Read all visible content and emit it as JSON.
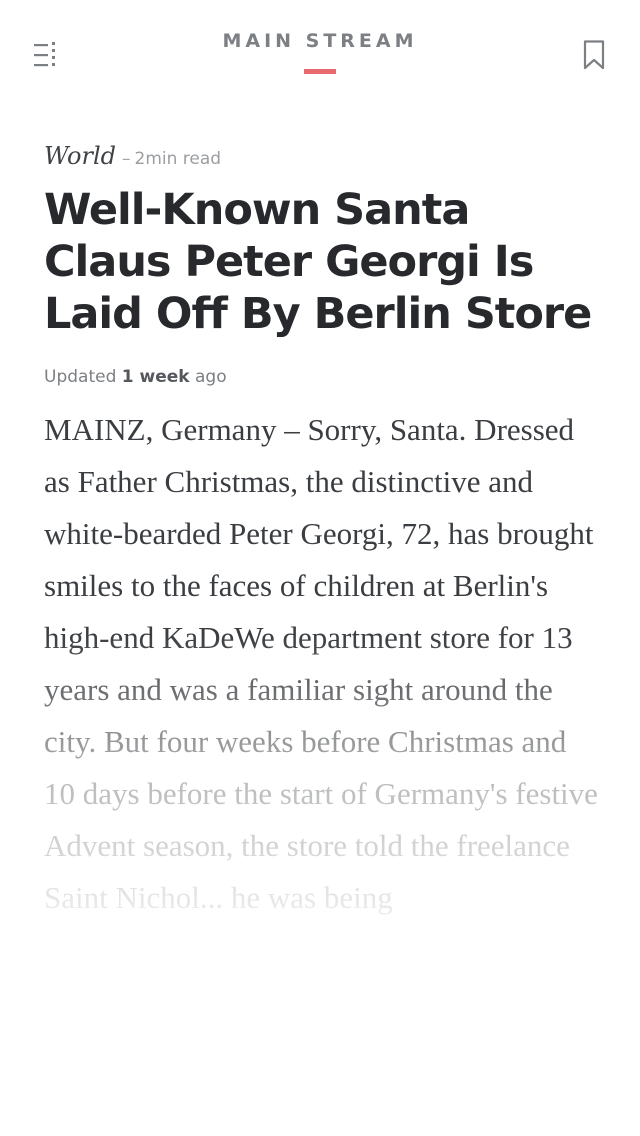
{
  "header": {
    "title": "MAIN STREAM",
    "menu_icon": "menu-icon",
    "bookmark_icon": "bookmark-icon",
    "accent_color": "#e86a6f"
  },
  "article": {
    "category": "World",
    "separator": "–",
    "read_time": "2min read",
    "headline": "Well-Known Santa Claus Peter Georgi Is Laid Off By Berlin Store",
    "updated_prefix": "Updated",
    "updated_value": "1 week",
    "updated_suffix": "ago",
    "body": "MAINZ, Germany – Sorry, Santa. Dressed as Father Christmas, the distinctive and white-bearded Peter Georgi, 72, has brought smiles to the faces of children at Berlin's high-end KaDeWe department store for 13 years and was a familiar sight around the city. But four weeks before Christmas and 10 days before the start of Germany's festive Advent season, the store told the freelance Saint Nichol... he was being"
  }
}
